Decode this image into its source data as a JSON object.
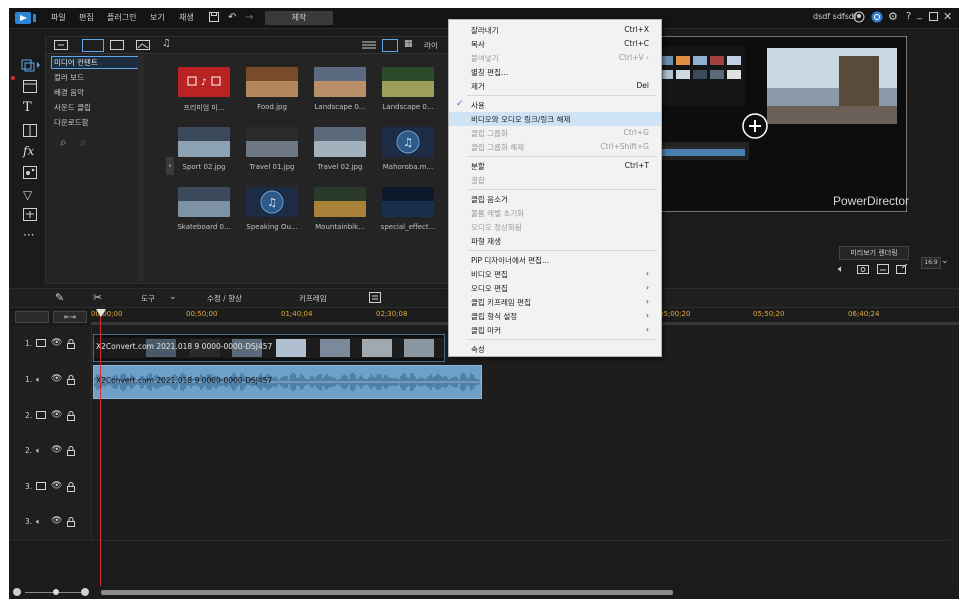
{
  "titlebar": {
    "menu": [
      "파일",
      "편집",
      "플러그인",
      "보기",
      "재생"
    ],
    "produce_label": "제작",
    "user_name": "dsdf sdfsdf",
    "help": "?"
  },
  "library": {
    "categories": [
      "미디어 컨텐트",
      "컬러 보드",
      "배경 음악",
      "사운드 클립",
      "다운로드함"
    ],
    "view_option": "라이",
    "thumbs": [
      {
        "label": "프리미엄 미...",
        "kind": "premium"
      },
      {
        "label": "Food.jpg",
        "kind": "food"
      },
      {
        "label": "Landscape 0...",
        "kind": "landscape1"
      },
      {
        "label": "Landscape 0...",
        "kind": "landscape2"
      },
      {
        "label": "Sport 02.jpg",
        "kind": "sport"
      },
      {
        "label": "Travel 01.jpg",
        "kind": "travel1"
      },
      {
        "label": "Travel 02.jpg",
        "kind": "travel2"
      },
      {
        "label": "Mahoroba.m...",
        "kind": "music"
      },
      {
        "label": "Skateboard 0...",
        "kind": "skate"
      },
      {
        "label": "Speaking Ou...",
        "kind": "music"
      },
      {
        "label": "Mountainbik...",
        "kind": "mountain"
      },
      {
        "label": "special_effect...",
        "kind": "effect"
      }
    ]
  },
  "preview": {
    "brand": "PowerDirector",
    "render_label": "미리보기 렌더링",
    "aspect": "16:9"
  },
  "toolbar": {
    "tools_label": "도구",
    "fix_label": "수정 / 향상",
    "keyframe_label": "키프레임"
  },
  "ruler": {
    "timecodes": [
      "00;00;00",
      "00;50;00",
      "01;40;04",
      "02;30;08",
      "05;00;20",
      "05;50;20",
      "06;40;24"
    ]
  },
  "tracks": [
    {
      "label": "1.",
      "type": "video"
    },
    {
      "label": "1.",
      "type": "audio"
    },
    {
      "label": "2.",
      "type": "video"
    },
    {
      "label": "2.",
      "type": "audio"
    },
    {
      "label": "3.",
      "type": "video"
    },
    {
      "label": "3.",
      "type": "audio"
    }
  ],
  "clips": {
    "video_name": "X2Convert.com 2021.018 9 0000-0000-DSJ457",
    "audio_name": "X2Convert.com 2021.018 9 0000-0000-DSJ457"
  },
  "context_menu": {
    "items": [
      {
        "label": "잘라내기",
        "shortcut": "Ctrl+X",
        "disabled": false
      },
      {
        "label": "복사",
        "shortcut": "Ctrl+C",
        "disabled": false
      },
      {
        "label": "붙여넣기",
        "shortcut": "Ctrl+V ›",
        "disabled": true
      },
      {
        "label": "별칭 편집...",
        "shortcut": "",
        "disabled": false
      },
      {
        "label": "제거",
        "shortcut": "Del",
        "disabled": false
      },
      {
        "sep": true
      },
      {
        "label": "사용",
        "shortcut": "",
        "disabled": false,
        "checked": true
      },
      {
        "label": "비디오와 오디오 링크/링크 해제",
        "shortcut": "",
        "disabled": false,
        "highlight": true
      },
      {
        "label": "클립 그룹화",
        "shortcut": "Ctrl+G",
        "disabled": true
      },
      {
        "label": "클립 그룹화 해제",
        "shortcut": "Ctrl+Shift+G",
        "disabled": true
      },
      {
        "sep": true
      },
      {
        "label": "분할",
        "shortcut": "Ctrl+T",
        "disabled": false
      },
      {
        "label": "결합",
        "shortcut": "",
        "disabled": true
      },
      {
        "sep": true
      },
      {
        "label": "클립 음소거",
        "shortcut": "",
        "disabled": false
      },
      {
        "label": "볼륨 레벨 초기화",
        "shortcut": "",
        "disabled": true
      },
      {
        "label": "오디오 정상화됨",
        "shortcut": "",
        "disabled": true
      },
      {
        "label": "파형 재생",
        "shortcut": "",
        "disabled": false
      },
      {
        "sep": true
      },
      {
        "label": "PiP 디자이너에서 편집...",
        "shortcut": "",
        "disabled": false
      },
      {
        "label": "비디오 편집",
        "shortcut": "›",
        "disabled": false
      },
      {
        "label": "오디오 편집",
        "shortcut": "›",
        "disabled": false
      },
      {
        "label": "클립 키프레임 편집",
        "shortcut": "›",
        "disabled": false
      },
      {
        "label": "클립 형식 설정",
        "shortcut": "›",
        "disabled": false
      },
      {
        "label": "클립 마커",
        "shortcut": "›",
        "disabled": false
      },
      {
        "sep": true
      },
      {
        "label": "속성",
        "shortcut": "",
        "disabled": false
      }
    ]
  },
  "colors": {
    "accent": "#2f7fd6",
    "timecode": "#e2a93a",
    "playhead": "#d23030"
  }
}
